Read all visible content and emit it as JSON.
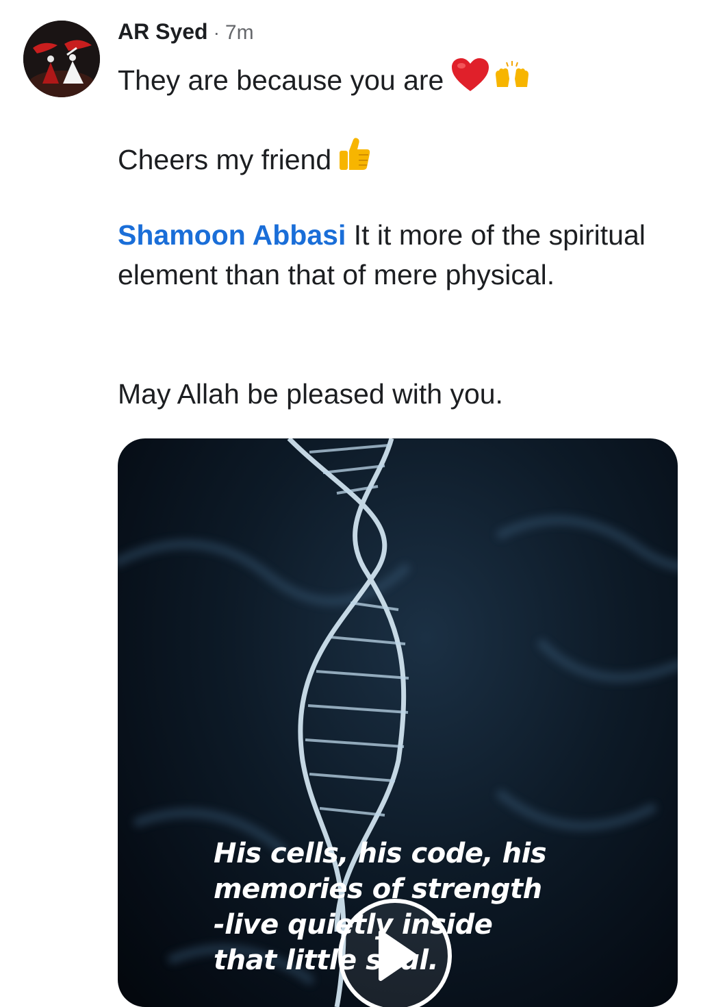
{
  "post": {
    "author": "AR Syed",
    "separator": "·",
    "time": "7m",
    "line1": "They are because you are",
    "line1_icons": [
      "red-heart-icon",
      "raised-hands-icon"
    ],
    "line2": "Cheers my friend",
    "line2_icons": [
      "thumbs-up-icon"
    ],
    "mention": "Shamoon Abbasi",
    "mention_text": " It it more of the spiritual element than that of mere physical.",
    "line4": "May Allah be pleased with you."
  },
  "media": {
    "kind": "video",
    "caption_lines": [
      "His cells, his code, his",
      "memories of strength",
      "-live quietly inside",
      "that little soul."
    ],
    "play_icon": "play-icon"
  },
  "colors": {
    "mention": "#1a6ed8",
    "text": "#1c1e21",
    "meta": "#65676b",
    "media_bg": "#0d1a27"
  }
}
